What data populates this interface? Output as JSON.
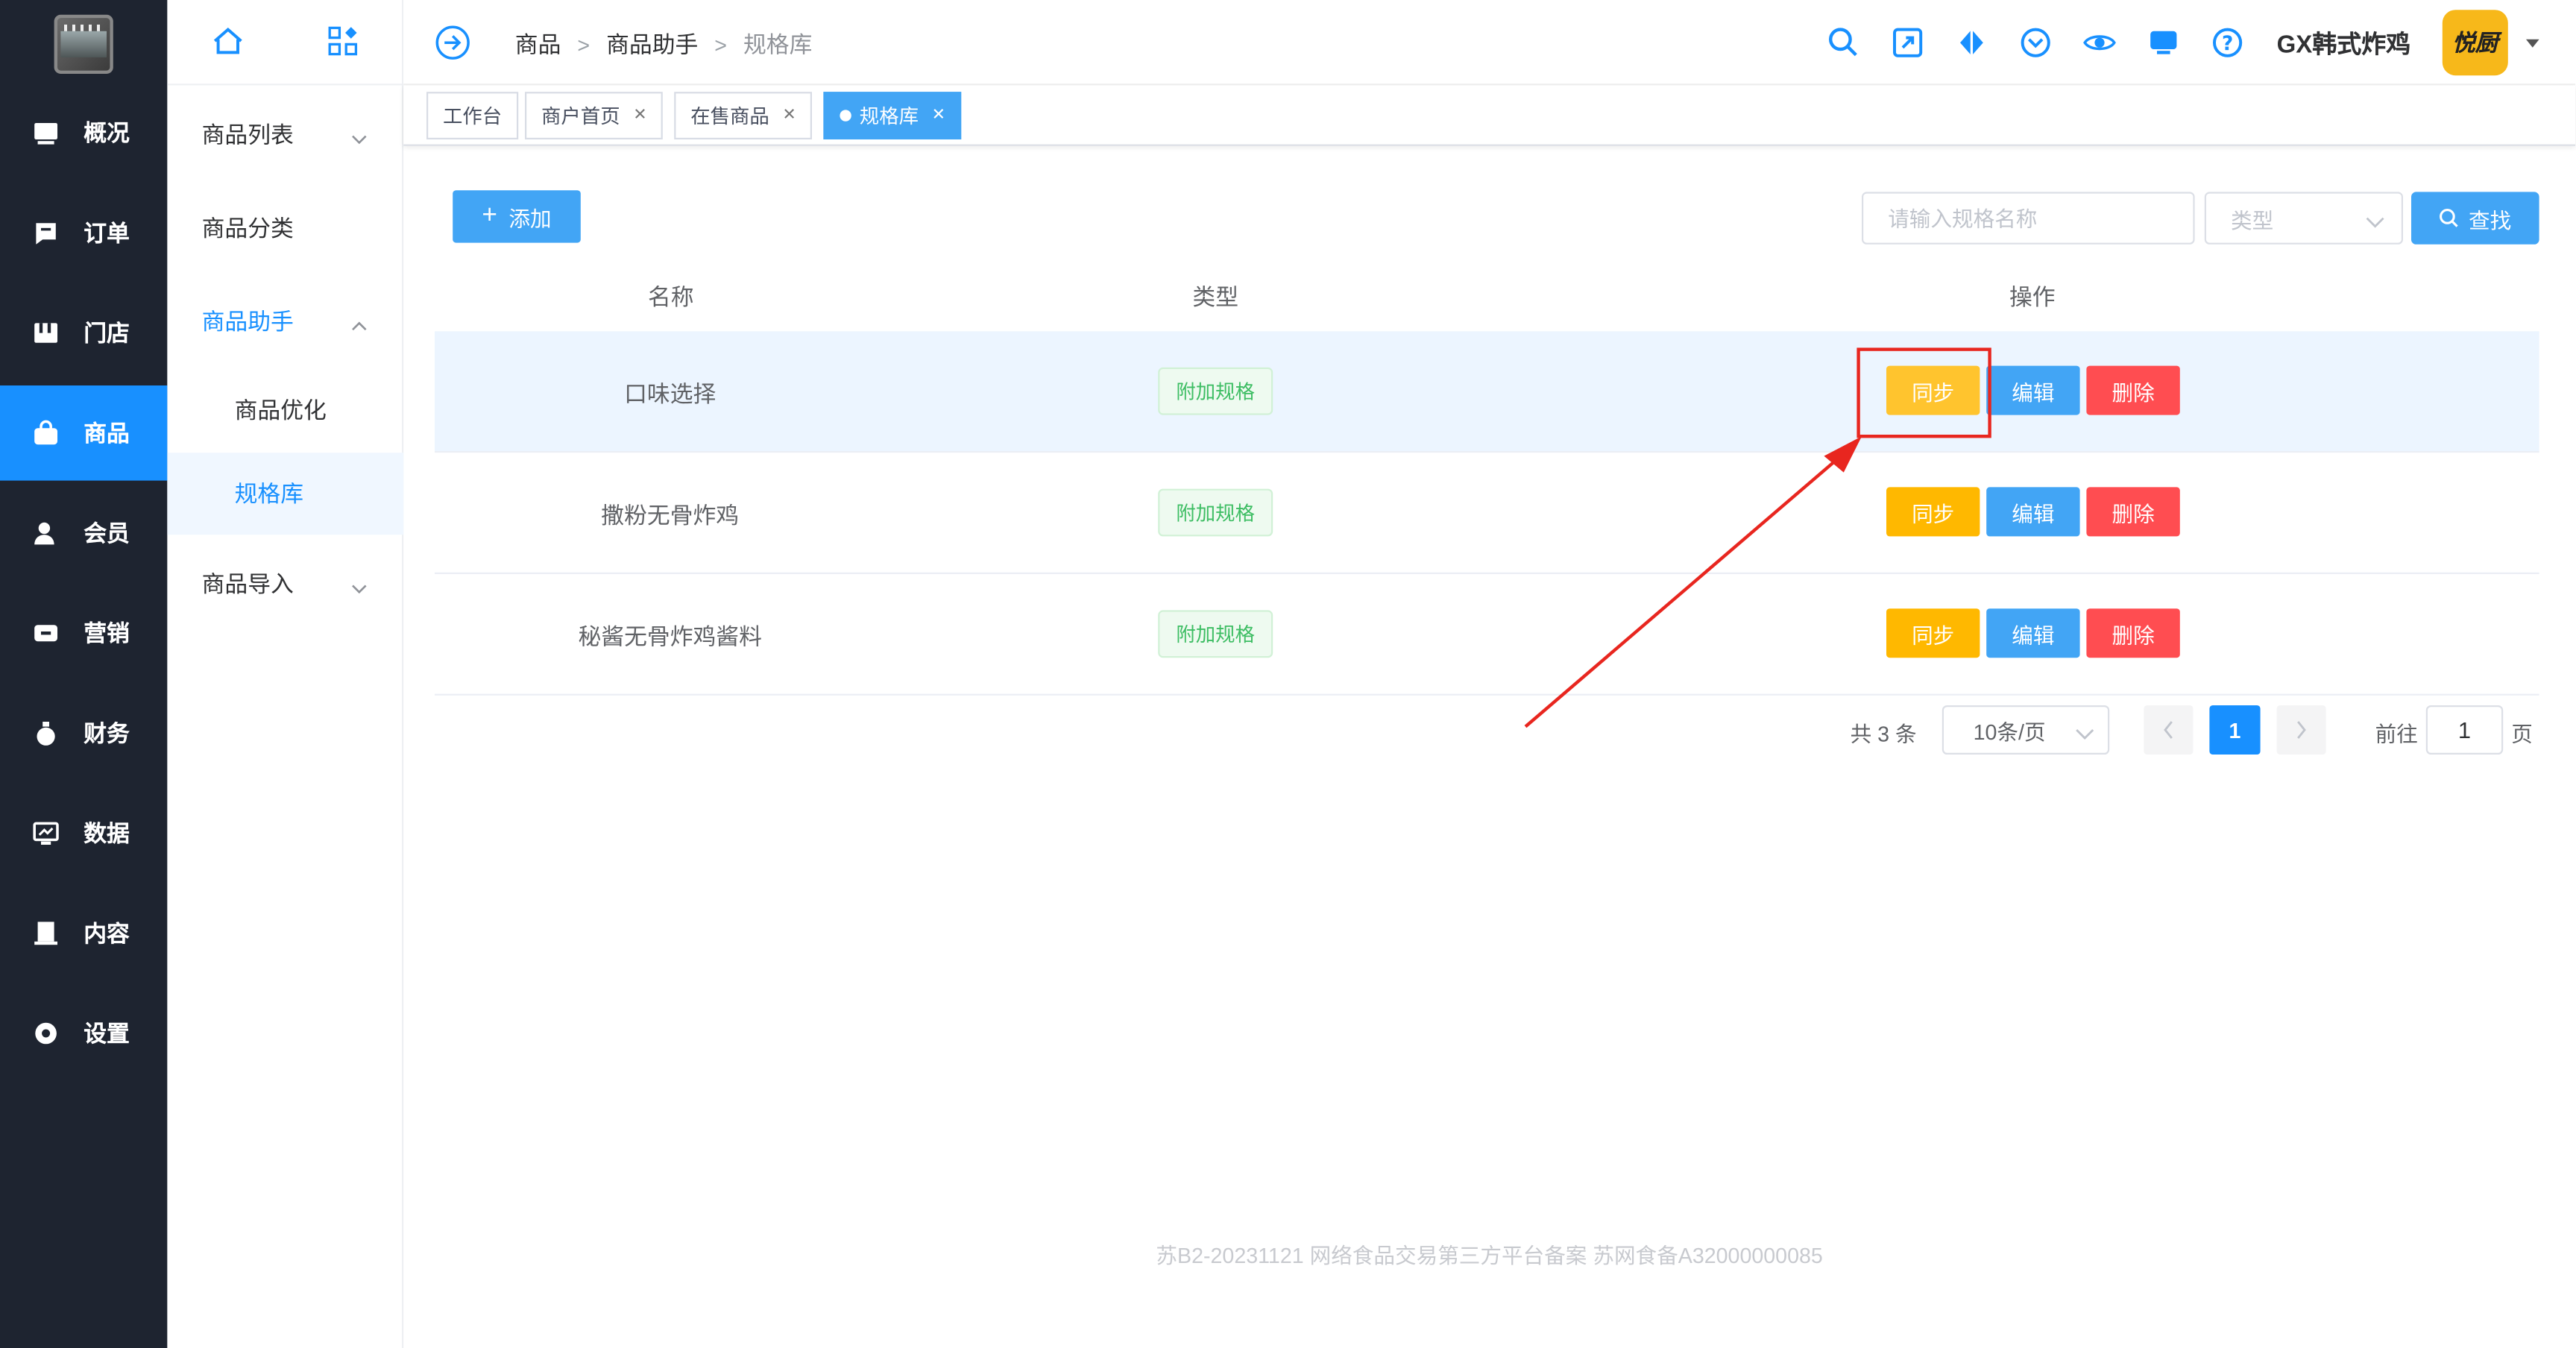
{
  "sidebar": {
    "items": [
      {
        "label": "概况",
        "icon": "dashboard-icon"
      },
      {
        "label": "订单",
        "icon": "order-icon"
      },
      {
        "label": "门店",
        "icon": "store-icon"
      },
      {
        "label": "商品",
        "icon": "shopping-bag-icon",
        "active": true
      },
      {
        "label": "会员",
        "icon": "member-icon"
      },
      {
        "label": "营销",
        "icon": "ticket-icon"
      },
      {
        "label": "财务",
        "icon": "money-bag-icon"
      },
      {
        "label": "数据",
        "icon": "data-monitor-icon"
      },
      {
        "label": "内容",
        "icon": "content-icon"
      },
      {
        "label": "设置",
        "icon": "settings-icon"
      }
    ]
  },
  "submenu": {
    "product_list": "商品列表",
    "product_category": "商品分类",
    "product_assistant": "商品助手",
    "product_optimize": "商品优化",
    "spec_library": "规格库",
    "product_import": "商品导入"
  },
  "header": {
    "breadcrumb": [
      "商品",
      "商品助手",
      "规格库"
    ],
    "shop_name": "GX韩式炸鸡",
    "avatar_text": "悦厨"
  },
  "tabs": [
    {
      "label": "工作台"
    },
    {
      "label": "商户首页"
    },
    {
      "label": "在售商品"
    },
    {
      "label": "规格库",
      "active": true
    }
  ],
  "toolbar": {
    "add_label": "添加",
    "search_placeholder": "请输入规格名称",
    "type_placeholder": "类型",
    "search_label": "查找"
  },
  "table": {
    "columns": [
      "名称",
      "类型",
      "操作"
    ],
    "rows": [
      {
        "name": "口味选择",
        "type": "附加规格"
      },
      {
        "name": "撒粉无骨炸鸡",
        "type": "附加规格"
      },
      {
        "name": "秘酱无骨炸鸡酱料",
        "type": "附加规格"
      }
    ],
    "actions": {
      "sync": "同步",
      "edit": "编辑",
      "delete": "删除"
    }
  },
  "pagination": {
    "total_text": "共 3 条",
    "page_size": "10条/页",
    "current_page": "1",
    "goto_label": "前往",
    "goto_value": "1",
    "page_suffix": "页"
  },
  "footer": {
    "text": "苏B2-20231121  网络食品交易第三方平台备案 苏网食备A32000000085"
  },
  "colors": {
    "accent": "#1890ff",
    "sync": "#ffb800",
    "delete": "#ff4d51",
    "annotation": "#e8261f"
  }
}
